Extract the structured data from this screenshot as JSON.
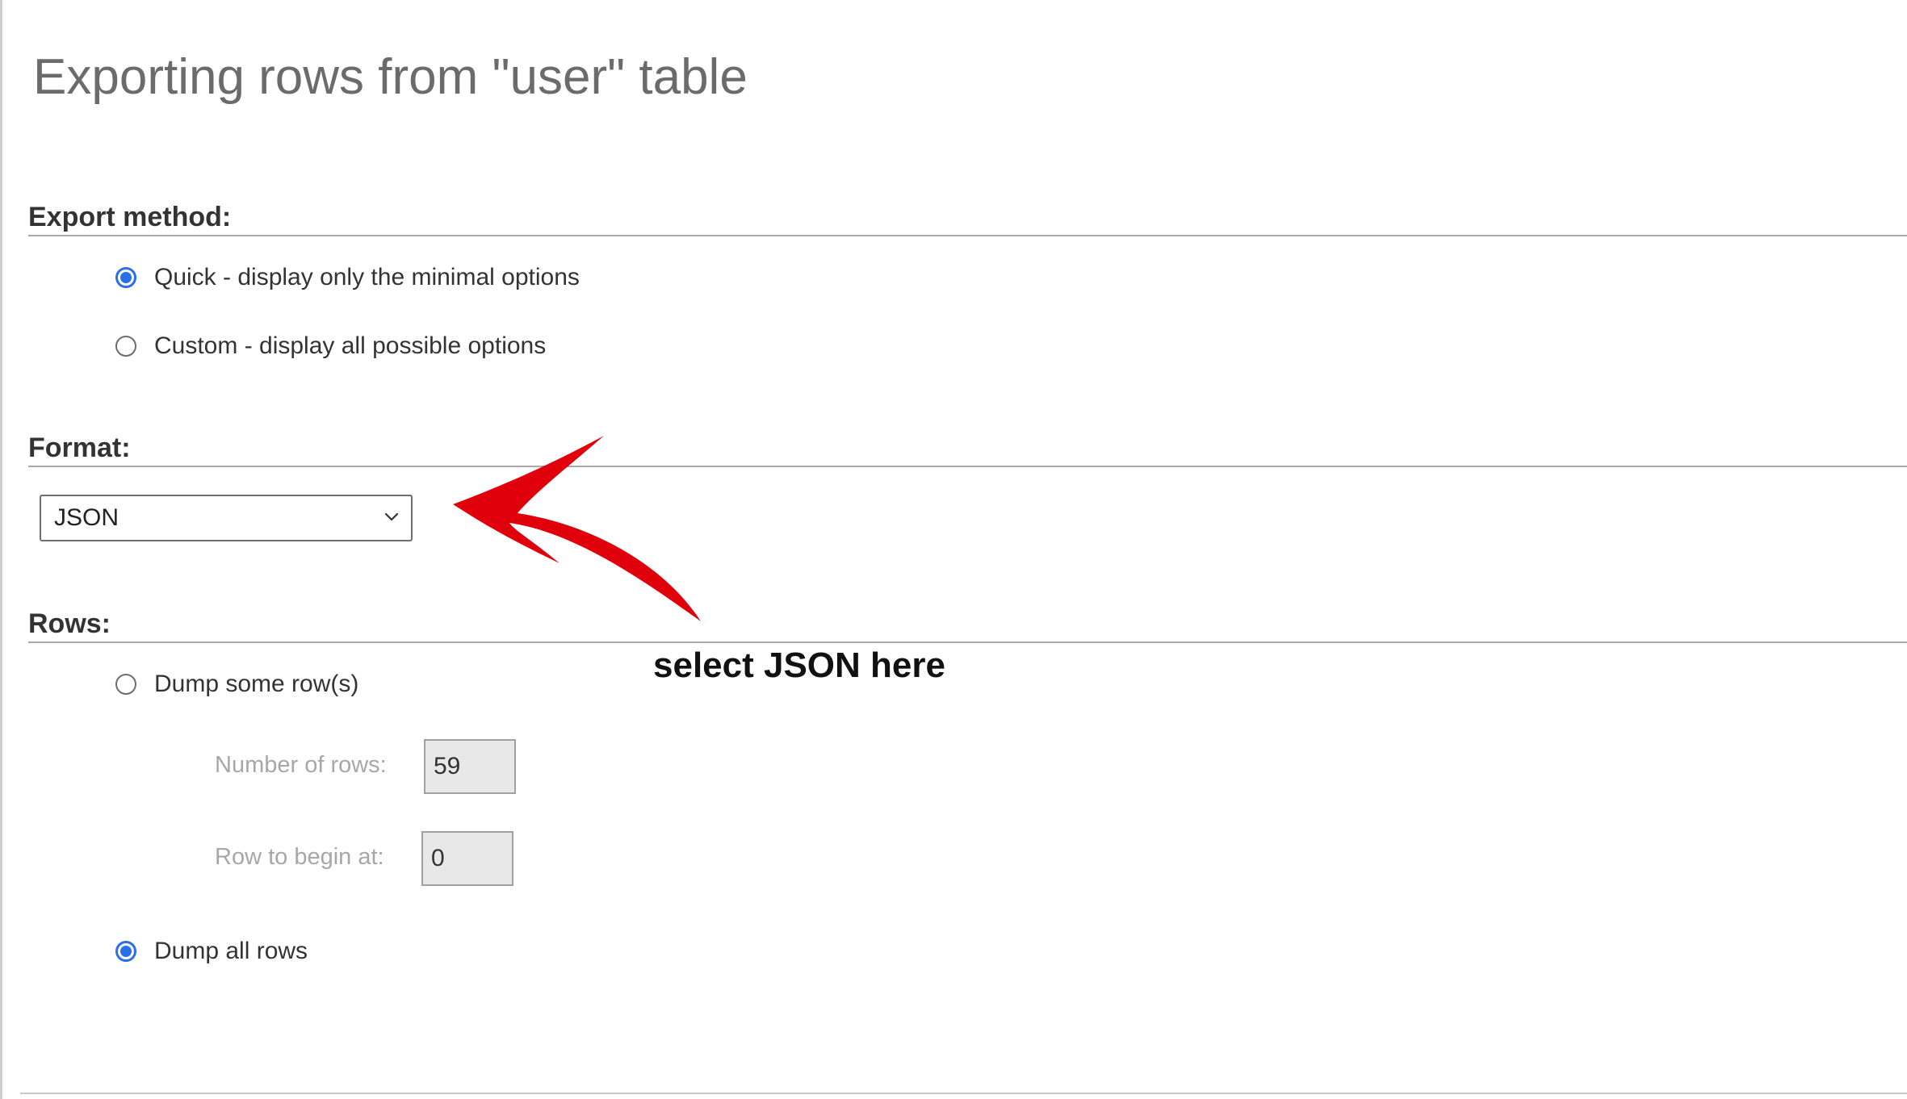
{
  "title": "Exporting rows from \"user\" table",
  "export_method": {
    "heading": "Export method:",
    "options": [
      {
        "label": "Quick - display only the minimal options",
        "selected": true
      },
      {
        "label": "Custom - display all possible options",
        "selected": false
      }
    ]
  },
  "format": {
    "heading": "Format:",
    "selected": "JSON"
  },
  "rows": {
    "heading": "Rows:",
    "dump_some_label": "Dump some row(s)",
    "dump_some_selected": false,
    "number_of_rows_label": "Number of rows:",
    "number_of_rows_value": "59",
    "row_begin_label": "Row to begin at:",
    "row_begin_value": "0",
    "dump_all_label": "Dump all rows",
    "dump_all_selected": true
  },
  "annotation": {
    "text": "select JSON here",
    "color": "#e0000b"
  },
  "colors": {
    "accent": "#2a6fe8"
  }
}
